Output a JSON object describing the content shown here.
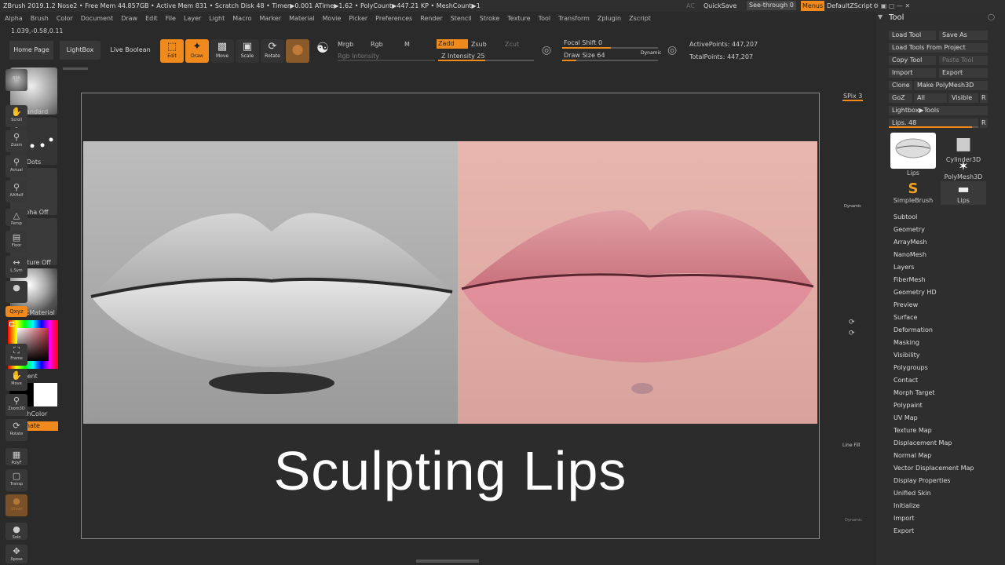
{
  "titlebar": {
    "text": "ZBrush 2019.1.2   Nose2   • Free Mem 44.857GB • Active Mem 831 • Scratch Disk 48 •  Timer▶0.001 ATime▶1.62 • PolyCount▶447.21 KP  • MeshCount▶1",
    "ac": "AC",
    "quicksave": "QuickSave",
    "seethrough": "See-through  0",
    "menus": "Menus",
    "defaultzscript": "DefaultZScript"
  },
  "menu": [
    "Alpha",
    "Brush",
    "Color",
    "Document",
    "Draw",
    "Edit",
    "File",
    "Layer",
    "Light",
    "Macro",
    "Marker",
    "Material",
    "Movie",
    "Picker",
    "Preferences",
    "Render",
    "Stencil",
    "Stroke",
    "Texture",
    "Tool",
    "Transform",
    "Zplugin",
    "Zscript"
  ],
  "coords": "1.039,-0.58,0.11",
  "toolbar": {
    "home": "Home Page",
    "lightbox": "LightBox",
    "liveboolean": "Live Boolean",
    "edit": "Edit",
    "draw": "Draw",
    "move": "Move",
    "scale": "Scale",
    "rotate": "Rotate",
    "mrgb": "Mrgb",
    "rgb": "Rgb",
    "m": "M",
    "rgb_intensity": "Rgb Intensity",
    "zadd": "Zadd",
    "zsub": "Zsub",
    "zcut": "Zcut",
    "z_intensity": "Z Intensity 25",
    "focal_shift": "Focal Shift 0",
    "draw_size": "Draw Size 64",
    "dynamic": "Dynamic",
    "active_points": "ActivePoints: 447,207",
    "total_points": "TotalPoints: 447,207"
  },
  "left": {
    "standard": "Standard",
    "dots": "Dots",
    "alpha_off": "Alpha Off",
    "texture_off": "Texture Off",
    "basic_material": "BasicMaterial",
    "gradient": "Gradient",
    "switchcolor": "SwitchColor",
    "alternate": "Alternate"
  },
  "canvas": {
    "title": "Sculpting Lips"
  },
  "right": {
    "bpr": "BPR",
    "spix": "SPix 3",
    "scroll": "Scroll",
    "zoom": "Zoom",
    "actual": "Actual",
    "aahalf": "AAHalf",
    "dynamic": "Dynamic",
    "persp": "Persp",
    "floor": "Floor",
    "lsym": "L.Sym",
    "xyz": "Qxyz",
    "frame": "Frame",
    "move": "Move",
    "zoom3d": "Zoom3D",
    "rotate": "Rotate",
    "linefill": "Line Fill",
    "polyf": "PolyF",
    "transp": "Transp",
    "ghost": "Ghost",
    "dynamic2": "Dynamic",
    "solo": "Solo",
    "xpose": "Xpose"
  },
  "tool": {
    "header": "Tool",
    "load_tool": "Load Tool",
    "save_as": "Save As",
    "load_from_project": "Load Tools From Project",
    "copy_tool": "Copy Tool",
    "paste_tool": "Paste Tool",
    "import": "Import",
    "export": "Export",
    "clone": "Clone",
    "make_polymesh": "Make PolyMesh3D",
    "goz": "GoZ",
    "all": "All",
    "visible": "Visible",
    "r": "R",
    "lightbox_tools": "Lightbox▶Tools",
    "lips_slider": "Lips. 48",
    "thumbs": [
      "Lips",
      "Cylinder3D",
      "PolyMesh3D",
      "SimpleBrush",
      "Lips"
    ],
    "items": [
      "Subtool",
      "Geometry",
      "ArrayMesh",
      "NanoMesh",
      "Layers",
      "FiberMesh",
      "Geometry HD",
      "Preview",
      "Surface",
      "Deformation",
      "Masking",
      "Visibility",
      "Polygroups",
      "Contact",
      "Morph Target",
      "Polypaint",
      "UV Map",
      "Texture Map",
      "Displacement Map",
      "Normal Map",
      "Vector Displacement Map",
      "Display Properties",
      "Unified Skin",
      "Initialize",
      "Import",
      "Export"
    ]
  }
}
